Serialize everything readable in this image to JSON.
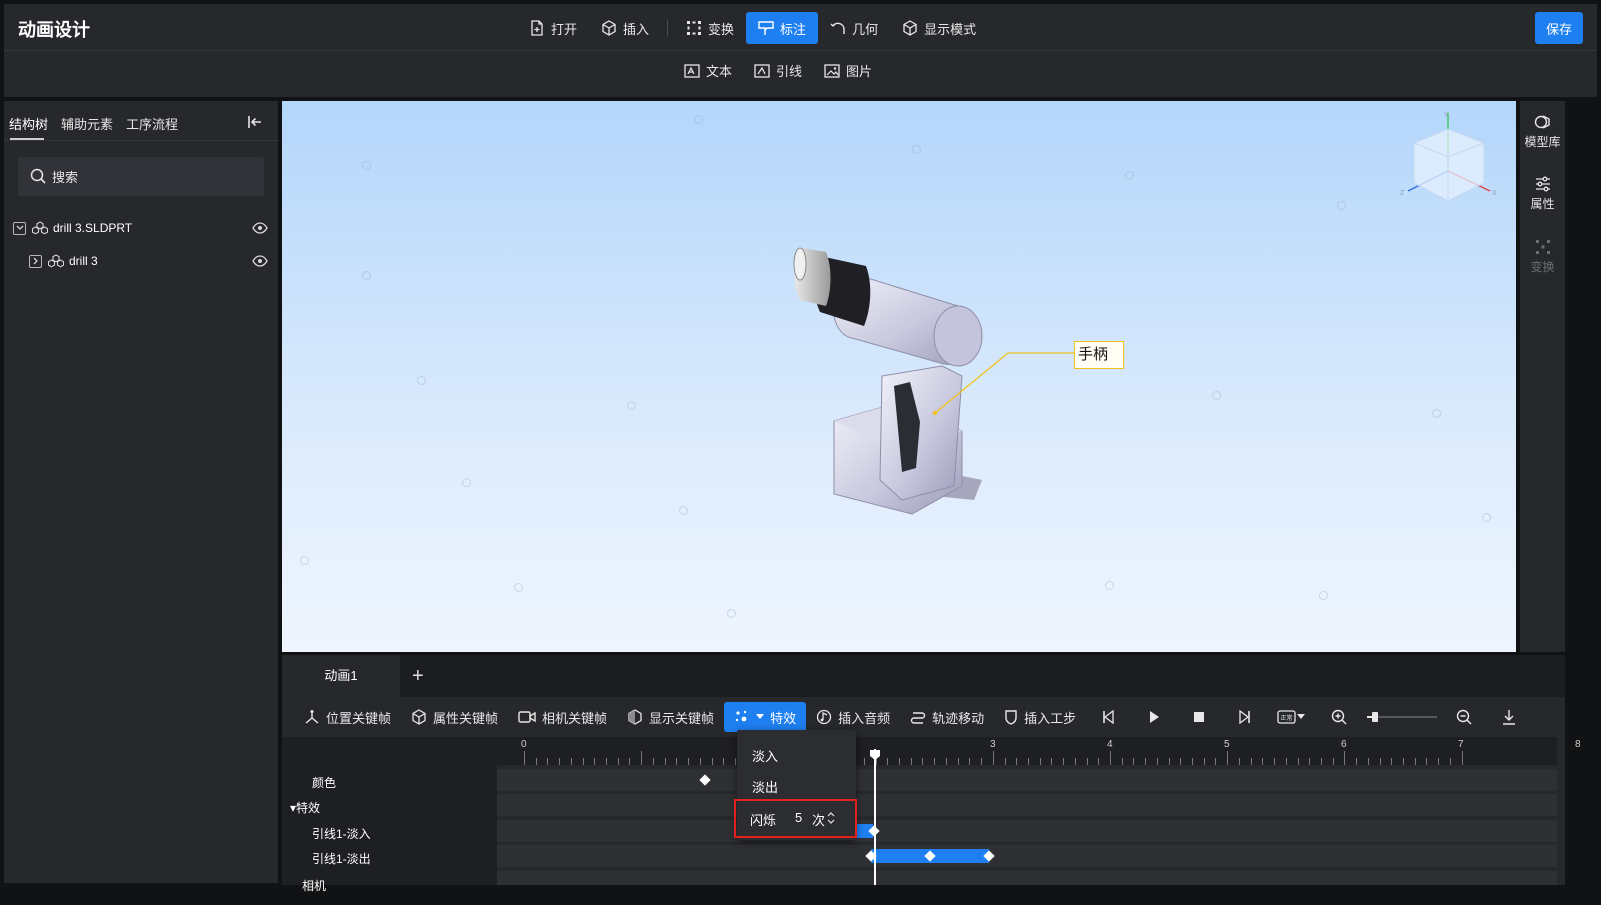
{
  "app": {
    "title": "动画设计",
    "save_label": "保存"
  },
  "main_toolbar": {
    "open": "打开",
    "insert": "插入",
    "transform": "变换",
    "annotate": "标注",
    "geometry": "几何",
    "display_mode": "显示模式"
  },
  "sub_toolbar": {
    "text": "文本",
    "leader": "引线",
    "image": "图片"
  },
  "left_panel": {
    "tabs": [
      "结构树",
      "辅助元素",
      "工序流程"
    ],
    "search_placeholder": "搜索",
    "tree": [
      {
        "label": "drill 3.SLDPRT",
        "expanded": true
      },
      {
        "label": "drill 3",
        "expanded": false
      }
    ]
  },
  "viewport": {
    "callout": "手柄",
    "axes": [
      "Y",
      "X",
      "Z"
    ]
  },
  "right_rail": {
    "model_library": "模型库",
    "properties": "属性",
    "transform": "变换"
  },
  "timeline": {
    "animation_tab": "动画1",
    "add_symbol": "+",
    "toolbar": {
      "position_kf": "位置关键帧",
      "attribute_kf": "属性关键帧",
      "camera_kf": "相机关键帧",
      "display_kf": "显示关键帧",
      "effects": "特效",
      "insert_audio": "插入音频",
      "track_move": "轨迹移动",
      "insert_step": "插入工步",
      "speed_badge": "正常"
    },
    "ruler": [
      "0",
      "1",
      "2",
      "3",
      "4",
      "5",
      "6",
      "7",
      "8"
    ],
    "tracks": {
      "color": "颜色",
      "effects_group": "▾特效",
      "leader_fade_in": "引线1-淡入",
      "leader_fade_out": "引线1-淡出",
      "camera": "相机"
    },
    "playhead_time": 3.0
  },
  "effects_menu": {
    "fade_in": "淡入",
    "fade_out": "淡出",
    "flash_label": "闪烁",
    "flash_count": "5",
    "flash_unit": "次"
  },
  "colors": {
    "accent": "#1e7ff0",
    "callout_border": "#f0c21c",
    "highlight": "#e0221e"
  }
}
